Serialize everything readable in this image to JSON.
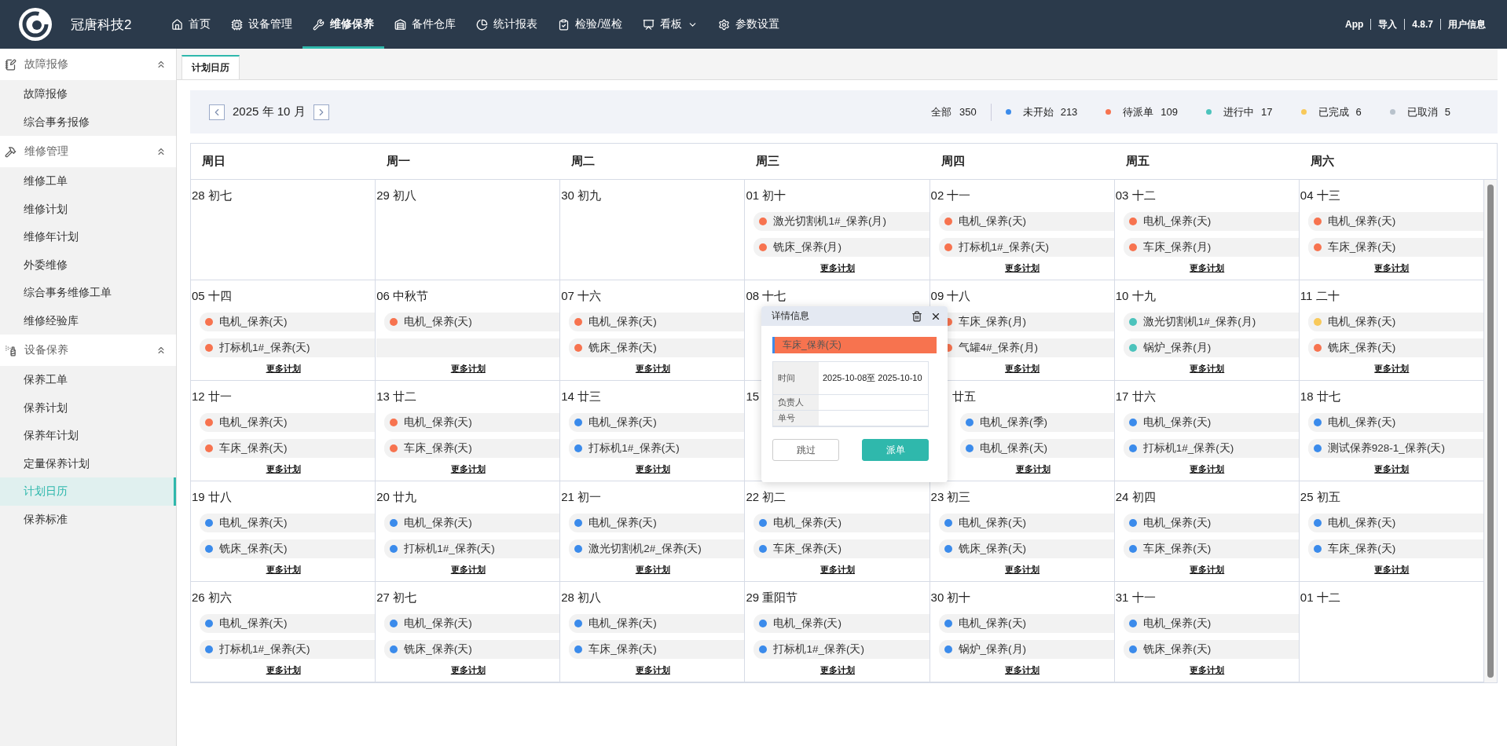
{
  "app": {
    "logo_text": "冠唐科技2"
  },
  "nav": [
    {
      "label": "首页",
      "selected": false,
      "dropdown": false
    },
    {
      "label": "设备管理",
      "selected": false,
      "dropdown": false
    },
    {
      "label": "维修保养",
      "selected": true,
      "dropdown": false
    },
    {
      "label": "备件仓库",
      "selected": false,
      "dropdown": false
    },
    {
      "label": "统计报表",
      "selected": false,
      "dropdown": false
    },
    {
      "label": "检验/巡检",
      "selected": false,
      "dropdown": false
    },
    {
      "label": "看板",
      "selected": false,
      "dropdown": true
    },
    {
      "label": "参数设置",
      "selected": false,
      "dropdown": false
    }
  ],
  "header_links": [
    "App",
    "导入",
    "4.8.7",
    "用户信息"
  ],
  "sidebar": {
    "groups": [
      {
        "title": "故障报修",
        "expanded": true,
        "items": [
          {
            "label": "故障报修",
            "selected": false
          },
          {
            "label": "综合事务报修",
            "selected": false
          }
        ]
      },
      {
        "title": "维修管理",
        "expanded": true,
        "items": [
          {
            "label": "维修工单",
            "selected": false
          },
          {
            "label": "维修计划",
            "selected": false
          },
          {
            "label": "维修年计划",
            "selected": false
          },
          {
            "label": "外委维修",
            "selected": false
          },
          {
            "label": "综合事务维修工单",
            "selected": false
          },
          {
            "label": "维修经验库",
            "selected": false
          }
        ]
      },
      {
        "title": "设备保养",
        "expanded": true,
        "items": [
          {
            "label": "保养工单",
            "selected": false
          },
          {
            "label": "保养计划",
            "selected": false
          },
          {
            "label": "保养年计划",
            "selected": false
          },
          {
            "label": "定量保养计划",
            "selected": false
          },
          {
            "label": "计划日历",
            "selected": true
          },
          {
            "label": "保养标准",
            "selected": false
          }
        ]
      }
    ]
  },
  "tabs": [
    {
      "label": "计划日历",
      "selected": true
    }
  ],
  "toolbar": {
    "month": "2025 年 10 月",
    "total_label": "全部",
    "total": "350",
    "legend": [
      {
        "label": "未开始",
        "count": "213",
        "color": "#3b8beb"
      },
      {
        "label": "待派单",
        "count": "109",
        "color": "#f7734f"
      },
      {
        "label": "进行中",
        "count": "17",
        "color": "#4cc3bc"
      },
      {
        "label": "已完成",
        "count": "6",
        "color": "#f8c95a"
      },
      {
        "label": "已取消",
        "count": "5",
        "color": "#b8c2cc"
      }
    ]
  },
  "calendar": {
    "weekdays": [
      "周日",
      "周一",
      "周二",
      "周三",
      "周四",
      "周五",
      "周六"
    ],
    "weeks": [
      [
        {
          "date": "28 初七",
          "covered": false
        },
        {
          "date": "29 初八",
          "covered": false
        },
        {
          "date": "30 初九",
          "covered": false
        },
        {
          "date": "01 初十",
          "covered": false,
          "events": [
            {
              "kind": "start",
              "name": "激光切割机1#_保养(月)",
              "color": "#f7734f"
            },
            {
              "kind": "start",
              "name": "铣床_保养(月)",
              "color": "#f7734f"
            }
          ],
          "more": "更多计划"
        },
        {
          "date": "02 十一",
          "covered": false,
          "events": [
            {
              "kind": "start",
              "name": "电机_保养(天)",
              "color": "#f7734f"
            },
            {
              "kind": "start",
              "name": "打标机1#_保养(天)",
              "color": "#f7734f"
            }
          ],
          "more": "更多计划"
        },
        {
          "date": "03 十二",
          "covered": false,
          "events": [
            {
              "kind": "start",
              "name": "电机_保养(天)",
              "color": "#f7734f"
            },
            {
              "kind": "start",
              "name": "车床_保养(月)",
              "color": "#f7734f"
            }
          ],
          "more": "更多计划"
        },
        {
          "date": "04 十三",
          "covered": false,
          "events": [
            {
              "kind": "start",
              "name": "电机_保养(天)",
              "color": "#f7734f"
            },
            {
              "kind": "start",
              "name": "车床_保养(天)",
              "color": "#f7734f"
            }
          ],
          "more": "更多计划"
        }
      ],
      [
        {
          "date": "05 十四",
          "covered": false,
          "events": [
            {
              "kind": "start",
              "name": "电机_保养(天)",
              "color": "#f7734f"
            },
            {
              "kind": "start",
              "name": "打标机1#_保养(天)",
              "color": "#f7734f"
            }
          ],
          "more": "更多计划"
        },
        {
          "date": "06 中秋节",
          "covered": false,
          "events": [
            {
              "kind": "start",
              "name": "电机_保养(天)",
              "color": "#f7734f"
            },
            {
              "kind": "span"
            }
          ],
          "more": "更多计划"
        },
        {
          "date": "07 十六",
          "covered": false,
          "events": [
            {
              "kind": "start",
              "name": "电机_保养(天)",
              "color": "#f7734f"
            },
            {
              "kind": "start",
              "name": "铣床_保养(天)",
              "color": "#f7734f"
            }
          ],
          "more": "更多计划"
        },
        {
          "date": "08 十七",
          "covered": false
        },
        {
          "date": "09 十八",
          "covered": false,
          "events": [
            {
              "kind": "start",
              "name": "车床_保养(月)",
              "color": "#f7734f"
            },
            {
              "kind": "start",
              "name": "气罐4#_保养(月)",
              "color": "#f7734f"
            }
          ],
          "more": "更多计划"
        },
        {
          "date": "10 十九",
          "covered": false,
          "events": [
            {
              "kind": "start",
              "name": "激光切割机1#_保养(月)",
              "color": "#4cc3bc"
            },
            {
              "kind": "start",
              "name": "锅炉_保养(月)",
              "color": "#4cc3bc"
            }
          ],
          "more": "更多计划"
        },
        {
          "date": "11 二十",
          "covered": false,
          "events": [
            {
              "kind": "start",
              "name": "电机_保养(天)",
              "color": "#f8c95a"
            },
            {
              "kind": "start",
              "name": "铣床_保养(天)",
              "color": "#f7734f"
            }
          ],
          "more": "更多计划"
        }
      ],
      [
        {
          "date": "12 廿一",
          "covered": false,
          "events": [
            {
              "kind": "start",
              "name": "电机_保养(天)",
              "color": "#f7734f"
            },
            {
              "kind": "start",
              "name": "车床_保养(天)",
              "color": "#f7734f"
            }
          ],
          "more": "更多计划"
        },
        {
          "date": "13 廿二",
          "covered": false,
          "events": [
            {
              "kind": "start",
              "name": "电机_保养(天)",
              "color": "#f7734f"
            },
            {
              "kind": "start",
              "name": "车床_保养(天)",
              "color": "#f7734f"
            }
          ],
          "more": "更多计划"
        },
        {
          "date": "14 廿三",
          "covered": false,
          "events": [
            {
              "kind": "start",
              "name": "电机_保养(天)",
              "color": "#3b8beb"
            },
            {
              "kind": "start",
              "name": "打标机1#_保养(天)",
              "color": "#3b8beb"
            }
          ],
          "more": "更多计划"
        },
        {
          "date": "15",
          "covered": false
        },
        {
          "date": "廿五",
          "covered": true,
          "events": [
            {
              "kind": "start",
              "name": "电机_保养(季)",
              "color": "#3b8beb"
            },
            {
              "kind": "start",
              "name": "电机_保养(天)",
              "color": "#3b8beb"
            }
          ],
          "more": "更多计划"
        },
        {
          "date": "17 廿六",
          "covered": false,
          "events": [
            {
              "kind": "start",
              "name": "电机_保养(天)",
              "color": "#3b8beb"
            },
            {
              "kind": "start",
              "name": "打标机1#_保养(天)",
              "color": "#3b8beb"
            }
          ],
          "more": "更多计划"
        },
        {
          "date": "18 廿七",
          "covered": false,
          "events": [
            {
              "kind": "start",
              "name": "电机_保养(天)",
              "color": "#3b8beb"
            },
            {
              "kind": "start",
              "name": "测试保养928-1_保养(天)",
              "color": "#3b8beb"
            }
          ],
          "more": "更多计划"
        }
      ],
      [
        {
          "date": "19 廿八",
          "covered": false,
          "events": [
            {
              "kind": "start",
              "name": "电机_保养(天)",
              "color": "#3b8beb"
            },
            {
              "kind": "start",
              "name": "铣床_保养(天)",
              "color": "#3b8beb"
            }
          ],
          "more": "更多计划"
        },
        {
          "date": "20 廿九",
          "covered": false,
          "events": [
            {
              "kind": "start",
              "name": "电机_保养(天)",
              "color": "#3b8beb"
            },
            {
              "kind": "start",
              "name": "打标机1#_保养(天)",
              "color": "#3b8beb"
            }
          ],
          "more": "更多计划"
        },
        {
          "date": "21 初一",
          "covered": false,
          "events": [
            {
              "kind": "start",
              "name": "电机_保养(天)",
              "color": "#3b8beb"
            },
            {
              "kind": "start",
              "name": "激光切割机2#_保养(天)",
              "color": "#3b8beb"
            }
          ],
          "more": "更多计划"
        },
        {
          "date": "22 初二",
          "covered": false,
          "events": [
            {
              "kind": "start",
              "name": "电机_保养(天)",
              "color": "#3b8beb"
            },
            {
              "kind": "start",
              "name": "车床_保养(天)",
              "color": "#3b8beb"
            }
          ],
          "more": "更多计划"
        },
        {
          "date": "23 初三",
          "covered": false,
          "events": [
            {
              "kind": "start",
              "name": "电机_保养(天)",
              "color": "#3b8beb"
            },
            {
              "kind": "start",
              "name": "铣床_保养(天)",
              "color": "#3b8beb"
            }
          ],
          "more": "更多计划"
        },
        {
          "date": "24 初四",
          "covered": false,
          "events": [
            {
              "kind": "start",
              "name": "电机_保养(天)",
              "color": "#3b8beb"
            },
            {
              "kind": "start",
              "name": "车床_保养(天)",
              "color": "#3b8beb"
            }
          ],
          "more": "更多计划"
        },
        {
          "date": "25 初五",
          "covered": false,
          "events": [
            {
              "kind": "start",
              "name": "电机_保养(天)",
              "color": "#3b8beb"
            },
            {
              "kind": "start",
              "name": "车床_保养(天)",
              "color": "#3b8beb"
            }
          ],
          "more": "更多计划"
        }
      ],
      [
        {
          "date": "26 初六",
          "covered": false,
          "events": [
            {
              "kind": "start",
              "name": "电机_保养(天)",
              "color": "#3b8beb"
            },
            {
              "kind": "start",
              "name": "打标机1#_保养(天)",
              "color": "#3b8beb"
            }
          ],
          "more": "更多计划"
        },
        {
          "date": "27 初七",
          "covered": false,
          "events": [
            {
              "kind": "start",
              "name": "电机_保养(天)",
              "color": "#3b8beb"
            },
            {
              "kind": "start",
              "name": "铣床_保养(天)",
              "color": "#3b8beb"
            }
          ],
          "more": "更多计划"
        },
        {
          "date": "28 初八",
          "covered": false,
          "events": [
            {
              "kind": "start",
              "name": "电机_保养(天)",
              "color": "#3b8beb"
            },
            {
              "kind": "start",
              "name": "车床_保养(天)",
              "color": "#3b8beb"
            }
          ],
          "more": "更多计划"
        },
        {
          "date": "29 重阳节",
          "covered": false,
          "events": [
            {
              "kind": "start",
              "name": "电机_保养(天)",
              "color": "#3b8beb"
            },
            {
              "kind": "start",
              "name": "打标机1#_保养(天)",
              "color": "#3b8beb"
            }
          ],
          "more": "更多计划"
        },
        {
          "date": "30 初十",
          "covered": false,
          "events": [
            {
              "kind": "start",
              "name": "电机_保养(天)",
              "color": "#3b8beb"
            },
            {
              "kind": "start",
              "name": "锅炉_保养(月)",
              "color": "#3b8beb"
            }
          ],
          "more": "更多计划"
        },
        {
          "date": "31 十一",
          "covered": false,
          "events": [
            {
              "kind": "start",
              "name": "电机_保养(天)",
              "color": "#3b8beb"
            },
            {
              "kind": "start",
              "name": "铣床_保养(天)",
              "color": "#3b8beb"
            }
          ],
          "more": "更多计划"
        },
        {
          "date": "01 十二",
          "covered": false
        }
      ]
    ]
  },
  "popup": {
    "title": "详情信息",
    "event": {
      "name": "车床_保养(天)",
      "color": "#f7734f"
    },
    "rows": [
      {
        "label": "时间",
        "value": "2025-10-08至 2025-10-10"
      },
      {
        "label": "负责人"
      },
      {
        "label": "单号"
      }
    ],
    "buttons": [
      {
        "label": "跳过",
        "kind": "secondary"
      },
      {
        "label": "派单",
        "kind": "primary"
      }
    ]
  }
}
